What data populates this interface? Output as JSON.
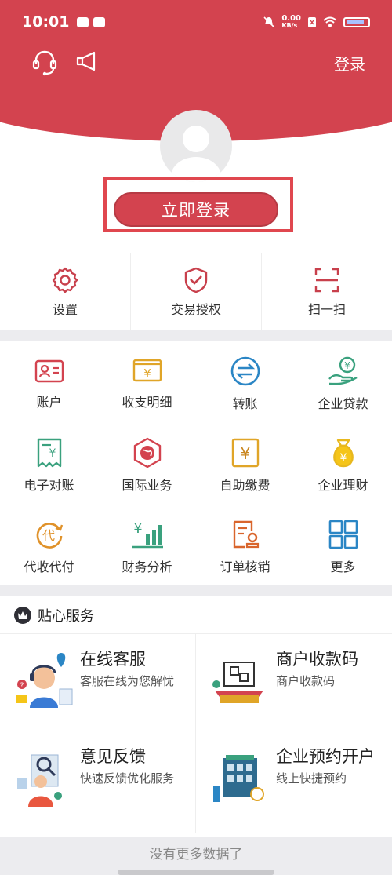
{
  "statusbar": {
    "time": "10:01",
    "speed": "0.00",
    "speed_unit": "KB/s"
  },
  "header": {
    "login_link": "登录",
    "login_button": "立即登录"
  },
  "quick_actions": [
    {
      "label": "设置",
      "icon": "gear-icon"
    },
    {
      "label": "交易授权",
      "icon": "shield-check-icon"
    },
    {
      "label": "扫一扫",
      "icon": "scan-icon"
    }
  ],
  "grid": [
    {
      "label": "账户",
      "icon": "account-card-icon"
    },
    {
      "label": "收支明细",
      "icon": "yuan-ledger-icon"
    },
    {
      "label": "转账",
      "icon": "transfer-icon"
    },
    {
      "label": "企业贷款",
      "icon": "loan-hand-icon"
    },
    {
      "label": "电子对账",
      "icon": "e-statement-icon"
    },
    {
      "label": "国际业务",
      "icon": "globe-icon"
    },
    {
      "label": "自助缴费",
      "icon": "yuan-payment-icon"
    },
    {
      "label": "企业理财",
      "icon": "money-bag-icon"
    },
    {
      "label": "代收代付",
      "icon": "collect-pay-icon"
    },
    {
      "label": "财务分析",
      "icon": "finance-chart-icon"
    },
    {
      "label": "订单核销",
      "icon": "order-verify-icon"
    },
    {
      "label": "更多",
      "icon": "more-grid-icon"
    }
  ],
  "services": {
    "title": "贴心服务",
    "items": [
      {
        "title": "在线客服",
        "desc": "客服在线为您解忧"
      },
      {
        "title": "商户收款码",
        "desc": "商户收款码"
      },
      {
        "title": "意见反馈",
        "desc": "快速反馈优化服务"
      },
      {
        "title": "企业预约开户",
        "desc": "线上快捷预约"
      }
    ]
  },
  "footer": {
    "text": "没有更多数据了"
  },
  "colors": {
    "brand_red": "#d3434f",
    "accent_blue": "#2b86c5",
    "accent_gold": "#e0a528",
    "accent_green": "#3aa17e"
  }
}
